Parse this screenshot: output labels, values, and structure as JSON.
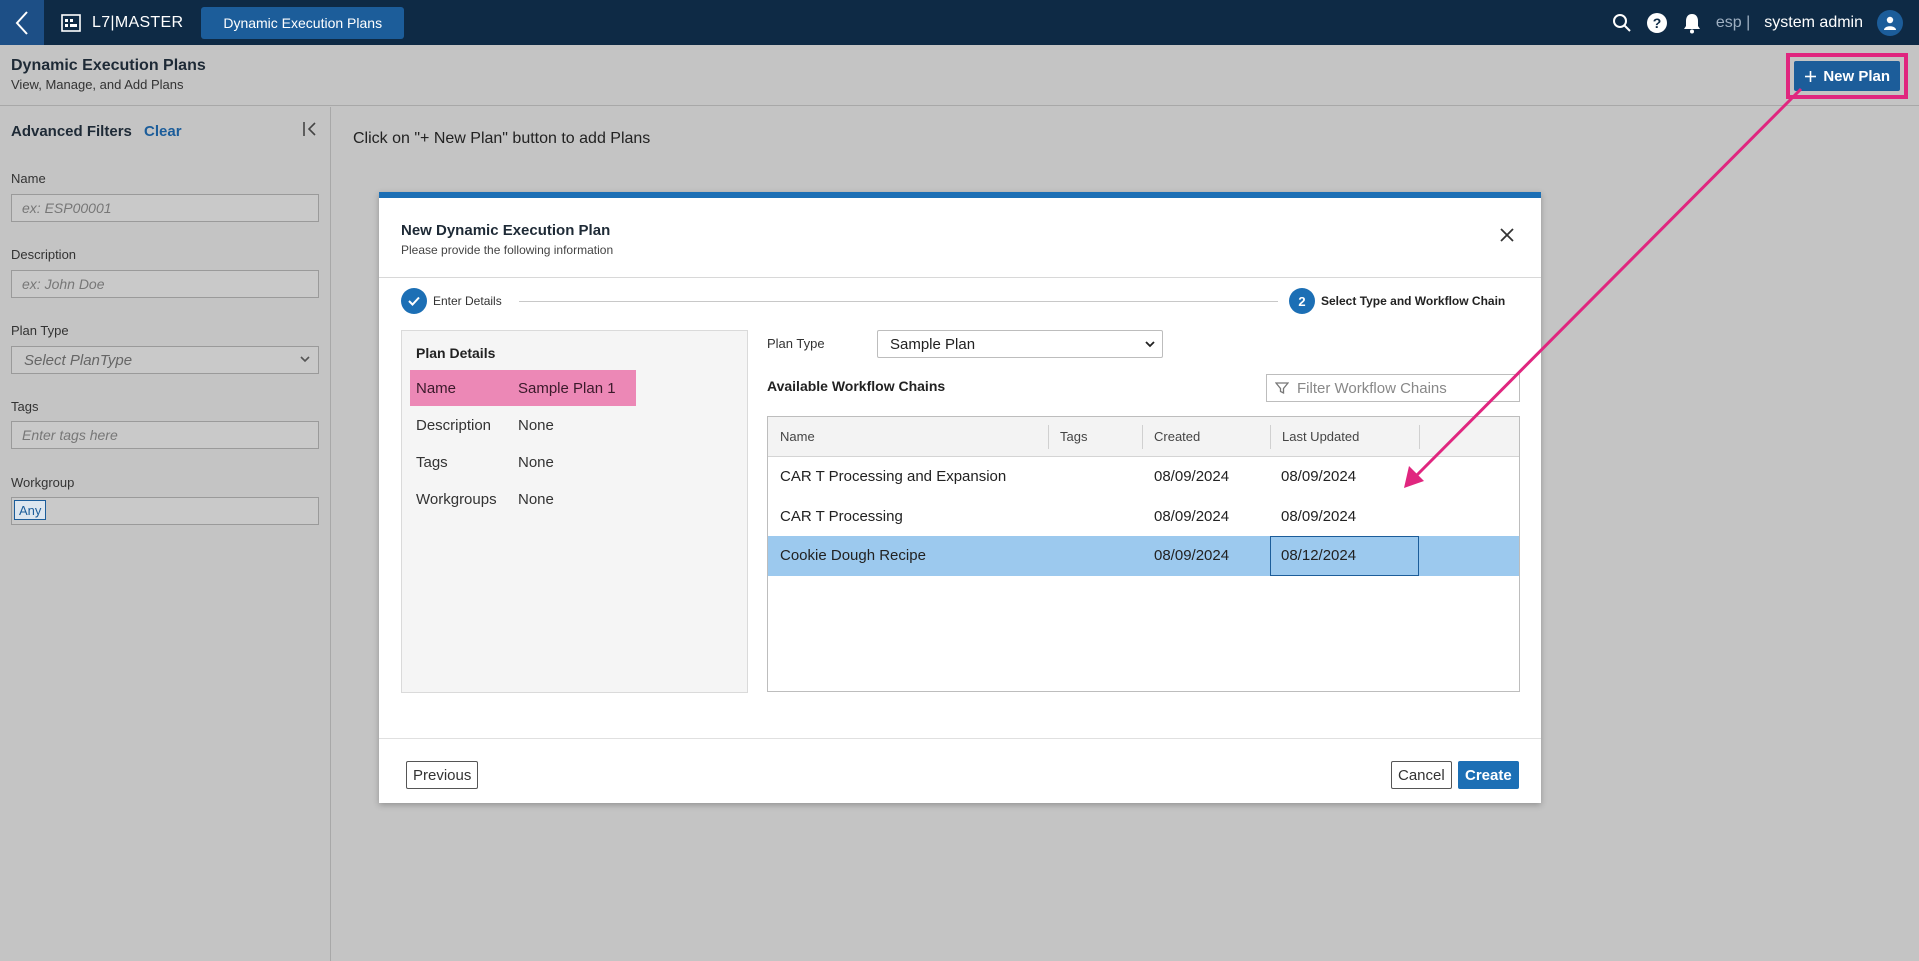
{
  "topbar": {
    "app_name": "L7|MASTER",
    "active_tab": "Dynamic Execution Plans",
    "tenant": "esp |",
    "user": "system admin"
  },
  "header": {
    "title": "Dynamic Execution Plans",
    "subtitle": "View, Manage, and Add Plans",
    "new_plan_label": "New Plan"
  },
  "sidebar": {
    "title": "Advanced Filters",
    "clear_label": "Clear",
    "fields": {
      "name_label": "Name",
      "name_placeholder": "ex: ESP00001",
      "description_label": "Description",
      "description_placeholder": "ex: John Doe",
      "plan_type_label": "Plan Type",
      "plan_type_value": "Select PlanType",
      "tags_label": "Tags",
      "tags_placeholder": "Enter tags here",
      "workgroup_label": "Workgroup",
      "workgroup_chip": "Any"
    }
  },
  "main": {
    "hint": "Click on \"+ New Plan\" button to add Plans"
  },
  "modal": {
    "title": "New Dynamic Execution Plan",
    "subtitle": "Please provide the following information",
    "steps": {
      "step1_label": "Enter Details",
      "step2_number": "2",
      "step2_label": "Select Type and Workflow Chain"
    },
    "plan_details": {
      "heading": "Plan Details",
      "rows": [
        {
          "key": "Name",
          "value": "Sample Plan 1"
        },
        {
          "key": "Description",
          "value": "None"
        },
        {
          "key": "Tags",
          "value": "None"
        },
        {
          "key": "Workgroups",
          "value": "None"
        }
      ]
    },
    "plan_type_label": "Plan Type",
    "plan_type_value": "Sample Plan",
    "workflow_chains_title": "Available Workflow Chains",
    "filter_placeholder": "Filter Workflow Chains",
    "table": {
      "columns": [
        "Name",
        "Tags",
        "Created",
        "Last Updated"
      ],
      "rows": [
        {
          "name": "CAR T Processing and Expansion",
          "tags": "",
          "created": "08/09/2024",
          "updated": "08/09/2024"
        },
        {
          "name": "CAR T Processing",
          "tags": "",
          "created": "08/09/2024",
          "updated": "08/09/2024"
        },
        {
          "name": "Cookie Dough Recipe",
          "tags": "",
          "created": "08/09/2024",
          "updated": "08/12/2024"
        }
      ]
    },
    "buttons": {
      "previous": "Previous",
      "cancel": "Cancel",
      "create": "Create"
    }
  },
  "colors": {
    "primary": "#1c5d9a",
    "highlight": "#e0267f",
    "selected_row": "#9cc9ee"
  }
}
